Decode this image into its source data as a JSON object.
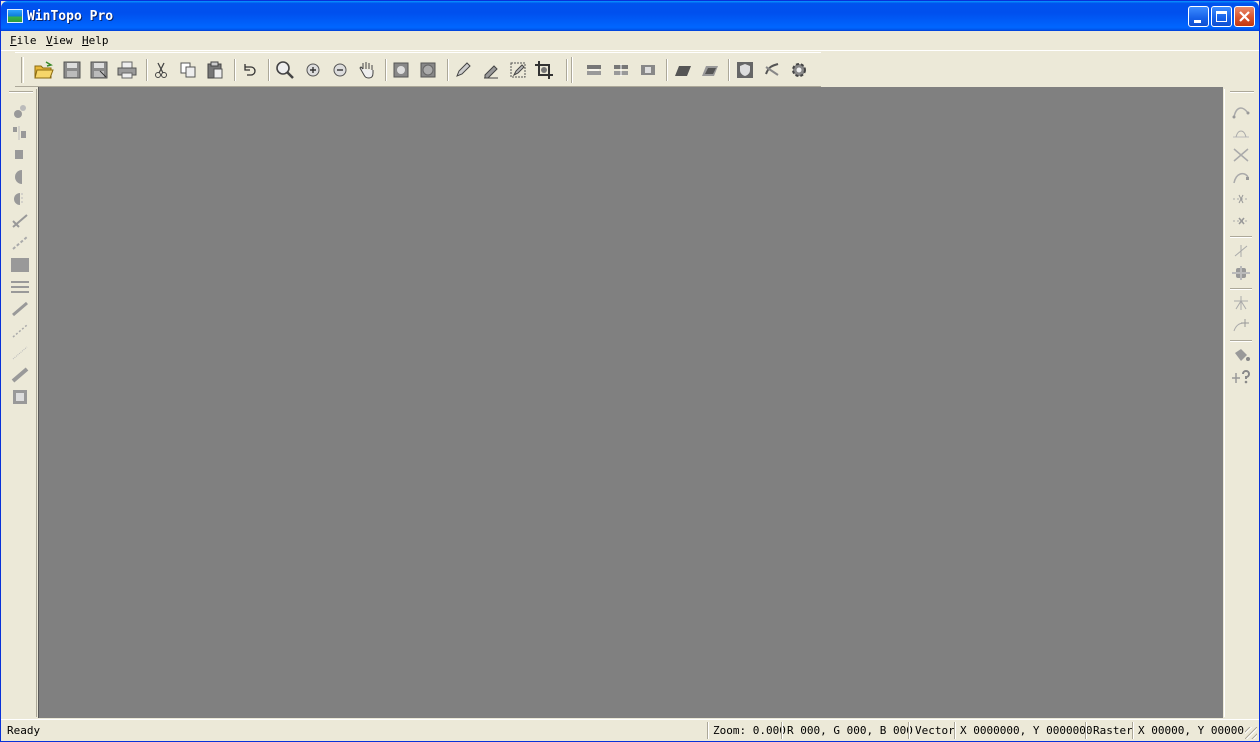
{
  "window": {
    "title": "WinTopo Pro"
  },
  "menu": {
    "items": [
      {
        "label": "File",
        "mnemonic": "F",
        "rest": "ile"
      },
      {
        "label": "View",
        "mnemonic": "V",
        "rest": "iew"
      },
      {
        "label": "Help",
        "mnemonic": "H",
        "rest": "elp"
      }
    ]
  },
  "toolbar": {
    "icons": [
      "open-folder-icon",
      "save-icon",
      "save-as-icon",
      "print-icon",
      "cut-icon",
      "copy-icon",
      "paste-icon",
      "undo-icon",
      "zoom-icon",
      "zoom-in-icon",
      "zoom-out-icon",
      "pan-hand-icon",
      "fit-view-icon",
      "actual-size-icon",
      "pencil-icon",
      "eraser-icon",
      "edit-region-icon",
      "crop-icon",
      "thin-icon",
      "skeleton-icon",
      "vectorize-icon",
      "layer-icon",
      "layers-icon",
      "shield-icon",
      "adjust-icon",
      "settings-gear-icon"
    ]
  },
  "left_tools": {
    "icons": [
      "node-icon",
      "split-icon",
      "fill-icon",
      "half-circle-icon",
      "mirror-icon",
      "polyline-icon",
      "dashed-line-icon",
      "rectangle-icon",
      "lines-icon",
      "pen-line-icon",
      "dotted-line-icon",
      "dot-line-icon",
      "thick-line-icon",
      "square-icon"
    ]
  },
  "right_tools": {
    "icons": [
      "curve-icon",
      "curve-points-icon",
      "cross-lines-icon",
      "curve-nodes-icon",
      "dashed-cross-icon",
      "dashed-x-icon",
      "crosshair-icon",
      "junction-icon",
      "branch-icon",
      "curve-plus-icon",
      "bucket-icon",
      "plus-question-icon"
    ]
  },
  "status": {
    "ready": "Ready",
    "zoom": "Zoom: 0.000",
    "rgb": "R 000, G 000, B 000",
    "vector_label": "Vector",
    "vector_coords": "X 0000000, Y 0000000",
    "raster_label": "Raster",
    "raster_coords": "X 00000, Y 00000"
  }
}
